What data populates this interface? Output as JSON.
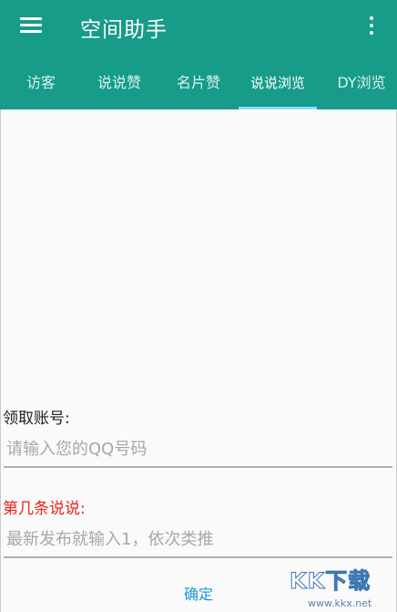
{
  "app_bar": {
    "title": "空间助手",
    "menu_icon": "hamburger-menu-icon",
    "overflow_icon": "more-vert-icon",
    "color": "#169c89"
  },
  "tabs": [
    {
      "label": "访客",
      "active": false
    },
    {
      "label": "说说赞",
      "active": false
    },
    {
      "label": "名片赞",
      "active": false
    },
    {
      "label": "说说浏览",
      "active": true
    },
    {
      "label": "DY浏览",
      "active": false
    }
  ],
  "form": {
    "account_label": "领取账号:",
    "account_placeholder": "请输入您的QQ号码",
    "index_label": "第几条说说:",
    "index_placeholder": "最新发布就输入1，依次类推",
    "confirm_label": "确定"
  },
  "watermark": {
    "logo_text": "KK下载",
    "url": "www.kkx.net"
  },
  "colors": {
    "accent": "#169c89",
    "tab_indicator": "#8fdcff",
    "warning_label": "#e8241c",
    "button_text": "#1f93d4"
  }
}
